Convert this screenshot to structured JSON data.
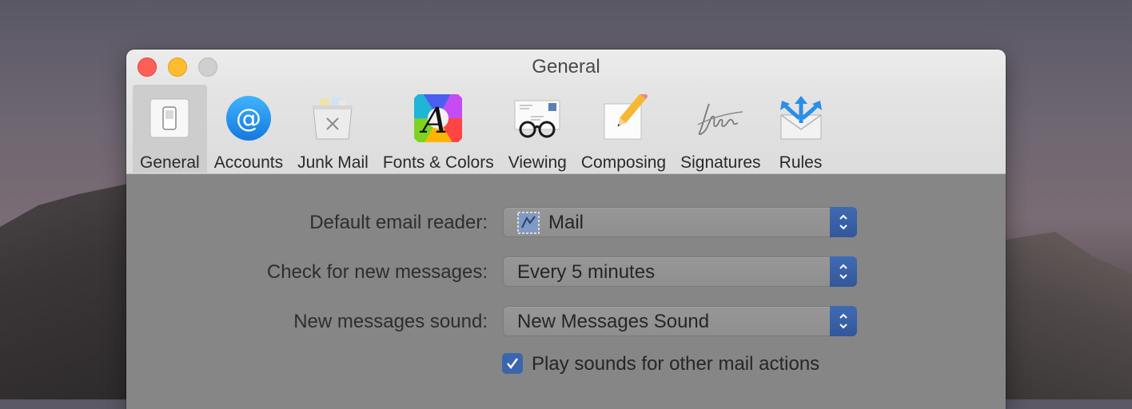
{
  "window": {
    "title": "General"
  },
  "toolbar": {
    "items": [
      {
        "label": "General",
        "icon": "switch-icon",
        "selected": true
      },
      {
        "label": "Accounts",
        "icon": "at-sign-icon",
        "selected": false
      },
      {
        "label": "Junk Mail",
        "icon": "trash-bin-icon",
        "selected": false
      },
      {
        "label": "Fonts & Colors",
        "icon": "color-wheel-font-icon",
        "selected": false
      },
      {
        "label": "Viewing",
        "icon": "glasses-envelope-icon",
        "selected": false
      },
      {
        "label": "Composing",
        "icon": "pencil-paper-icon",
        "selected": false
      },
      {
        "label": "Signatures",
        "icon": "signature-icon",
        "selected": false
      },
      {
        "label": "Rules",
        "icon": "envelope-arrows-icon",
        "selected": false
      }
    ]
  },
  "settings": {
    "default_reader": {
      "label": "Default email reader:",
      "value": "Mail",
      "icon": "mail-stamp-icon"
    },
    "check_messages": {
      "label": "Check for new messages:",
      "value": "Every 5 minutes"
    },
    "new_sound": {
      "label": "New messages sound:",
      "value": "New Messages Sound"
    },
    "play_sounds": {
      "label": "Play sounds for other mail actions",
      "checked": true
    }
  },
  "colors": {
    "accent": "#3b66ae",
    "close": "#fe5f57",
    "minimize": "#febc2e",
    "content_bg": "#868686"
  }
}
